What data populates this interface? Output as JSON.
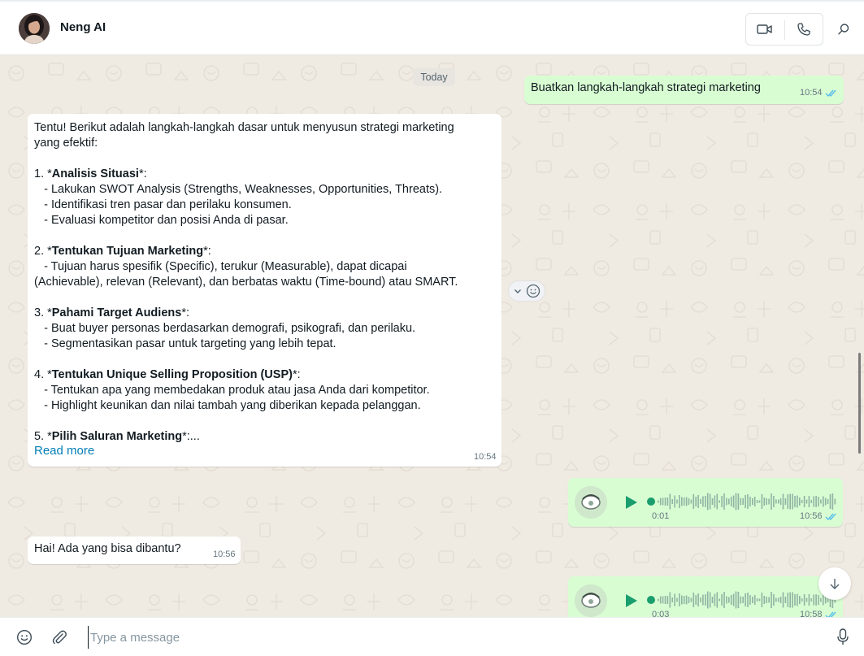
{
  "header": {
    "contact_name": "Neng AI",
    "avatar_icon": "avatar-photo",
    "video_call_icon": "video-icon",
    "voice_call_icon": "phone-icon",
    "search_icon": "search-icon"
  },
  "chat": {
    "date_separator": "Today",
    "messages": [
      {
        "direction": "outgoing",
        "text": "Buatkan langkah-langkah strategi marketing",
        "time": "10:54",
        "status": "read"
      },
      {
        "direction": "incoming",
        "lines": [
          [
            {
              "t": "Tentu! Berikut adalah langkah-langkah dasar untuk menyusun strategi marketing"
            }
          ],
          [
            {
              "t": "yang efektif:"
            }
          ],
          [
            {
              "t": ""
            }
          ],
          [
            {
              "t": "1. *"
            },
            {
              "t": "Analisis Situasi",
              "b": true
            },
            {
              "t": "*:"
            }
          ],
          [
            {
              "t": "   - Lakukan SWOT Analysis (Strengths, Weaknesses, Opportunities, Threats)."
            }
          ],
          [
            {
              "t": "   - Identifikasi tren pasar dan perilaku konsumen."
            }
          ],
          [
            {
              "t": "   - Evaluasi kompetitor dan posisi Anda di pasar."
            }
          ],
          [
            {
              "t": ""
            }
          ],
          [
            {
              "t": "2. *"
            },
            {
              "t": "Tentukan Tujuan Marketing",
              "b": true
            },
            {
              "t": "*:"
            }
          ],
          [
            {
              "t": "   - Tujuan harus spesifik (Specific), terukur (Measurable), dapat dicapai"
            }
          ],
          [
            {
              "t": "(Achievable), relevan (Relevant), dan berbatas waktu (Time-bound) atau SMART."
            }
          ],
          [
            {
              "t": ""
            }
          ],
          [
            {
              "t": "3. *"
            },
            {
              "t": "Pahami Target Audiens",
              "b": true
            },
            {
              "t": "*:"
            }
          ],
          [
            {
              "t": "   - Buat buyer personas berdasarkan demografi, psikografi, dan perilaku."
            }
          ],
          [
            {
              "t": "   - Segmentasikan pasar untuk targeting yang lebih tepat."
            }
          ],
          [
            {
              "t": ""
            }
          ],
          [
            {
              "t": "4. *"
            },
            {
              "t": "Tentukan Unique Selling Proposition (USP)",
              "b": true
            },
            {
              "t": "*:"
            }
          ],
          [
            {
              "t": "   - Tentukan apa yang membedakan produk atau jasa Anda dari kompetitor."
            }
          ],
          [
            {
              "t": "   - Highlight keunikan dan nilai tambah yang diberikan kepada pelanggan."
            }
          ],
          [
            {
              "t": ""
            }
          ],
          [
            {
              "t": "5. *"
            },
            {
              "t": "Pilih Saluran Marketing",
              "b": true
            },
            {
              "t": "*:..."
            }
          ]
        ],
        "read_more": "Read more",
        "time": "10:54"
      },
      {
        "direction": "outgoing",
        "type": "voice",
        "duration": "0:01",
        "time": "10:56",
        "status": "read"
      },
      {
        "direction": "incoming",
        "text": "Hai! Ada yang bisa dibantu?",
        "time": "10:56"
      },
      {
        "direction": "outgoing",
        "type": "voice",
        "duration": "0:03",
        "time": "10:58",
        "status": "read"
      }
    ]
  },
  "composer": {
    "placeholder": "Type a message",
    "emoji_icon": "emoji-icon",
    "attach_icon": "paperclip-icon",
    "mic_icon": "microphone-icon"
  },
  "colors": {
    "outgoing_bubble": "#d9fdd3",
    "incoming_bubble": "#ffffff",
    "wallpaper": "#efeae2",
    "link": "#027eb5",
    "read_ticks": "#53bdeb",
    "voice_accent": "#1a9e6e"
  }
}
